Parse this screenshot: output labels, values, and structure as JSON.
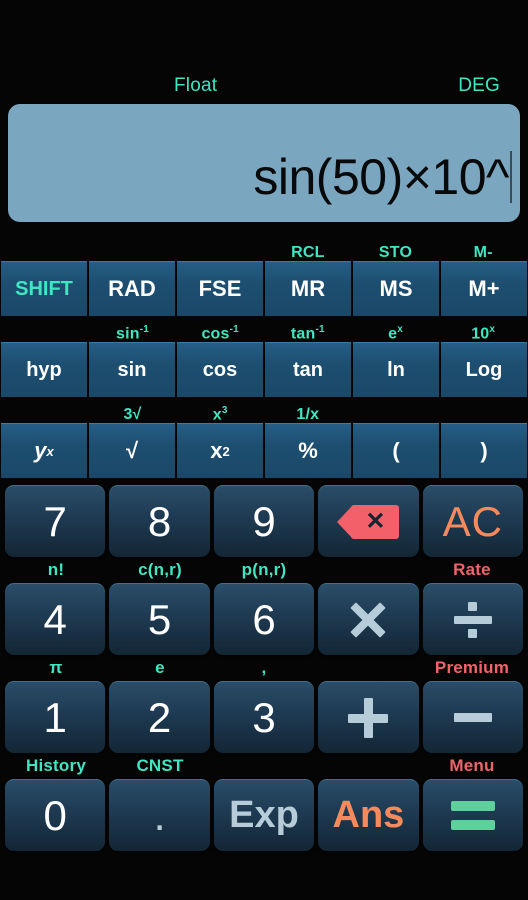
{
  "display": {
    "mode_float": "Float",
    "mode_angle": "DEG",
    "expression": "sin(50)×10^"
  },
  "function_rows": [
    {
      "secondary": [
        "",
        "",
        "",
        "RCL",
        "STO",
        "M-"
      ],
      "keys": [
        {
          "label": "SHIFT",
          "style": "shift"
        },
        {
          "label": "RAD",
          "style": "plain"
        },
        {
          "label": "FSE",
          "style": "plain"
        },
        {
          "label": "MR",
          "style": "plain"
        },
        {
          "label": "MS",
          "style": "plain"
        },
        {
          "label": "M+",
          "style": "plain"
        }
      ]
    },
    {
      "secondary": [
        "",
        "sin-1",
        "cos-1",
        "tan-1",
        "e^x",
        "10^x"
      ],
      "secondary_base": [
        "",
        "sin",
        "cos",
        "tan",
        "e",
        "10"
      ],
      "secondary_sup": [
        "",
        "-1",
        "-1",
        "-1",
        "x",
        "x"
      ],
      "keys": [
        {
          "label": "hyp",
          "style": "plain"
        },
        {
          "label": "sin",
          "style": "plain"
        },
        {
          "label": "cos",
          "style": "plain"
        },
        {
          "label": "tan",
          "style": "plain"
        },
        {
          "label": "ln",
          "style": "plain"
        },
        {
          "label": "Log",
          "style": "plain"
        }
      ]
    },
    {
      "secondary": [
        "",
        "3√",
        "x3",
        "1/x",
        "",
        ""
      ],
      "secondary_base": [
        "",
        "3√",
        "x",
        "1/x",
        "",
        ""
      ],
      "secondary_sup": [
        "",
        "",
        "3",
        "",
        "",
        ""
      ],
      "keys": [
        {
          "label": "y^x",
          "style": "pow"
        },
        {
          "label": "√",
          "style": "plain"
        },
        {
          "label": "x2",
          "style": "sq"
        },
        {
          "label": "%",
          "style": "plain"
        },
        {
          "label": "(",
          "style": "plain"
        },
        {
          "label": ")",
          "style": "plain"
        }
      ]
    }
  ],
  "keypad": [
    {
      "labels": [
        "",
        "",
        "",
        "",
        ""
      ],
      "label_colors": [
        "cyan",
        "cyan",
        "cyan",
        "cyan",
        "red"
      ],
      "keys": [
        {
          "name": "seven",
          "label": "7",
          "style": "num"
        },
        {
          "name": "eight",
          "label": "8",
          "style": "num"
        },
        {
          "name": "nine",
          "label": "9",
          "style": "num"
        },
        {
          "name": "backspace",
          "label": "",
          "style": "backspace"
        },
        {
          "name": "all-clear",
          "label": "AC",
          "style": "ac"
        }
      ]
    },
    {
      "labels": [
        "n!",
        "c(n,r)",
        "p(n,r)",
        "",
        "Rate"
      ],
      "label_colors": [
        "cyan",
        "cyan",
        "cyan",
        "cyan",
        "red"
      ],
      "keys": [
        {
          "name": "four",
          "label": "4",
          "style": "num"
        },
        {
          "name": "five",
          "label": "5",
          "style": "num"
        },
        {
          "name": "six",
          "label": "6",
          "style": "num"
        },
        {
          "name": "multiply",
          "label": "×",
          "style": "times"
        },
        {
          "name": "divide",
          "label": "÷",
          "style": "divide"
        }
      ]
    },
    {
      "labels": [
        "π",
        "e",
        ",",
        "",
        "Premium"
      ],
      "label_colors": [
        "cyan",
        "cyan",
        "cyan",
        "cyan",
        "red"
      ],
      "keys": [
        {
          "name": "one",
          "label": "1",
          "style": "num"
        },
        {
          "name": "two",
          "label": "2",
          "style": "num"
        },
        {
          "name": "three",
          "label": "3",
          "style": "num"
        },
        {
          "name": "plus",
          "label": "+",
          "style": "plus"
        },
        {
          "name": "minus",
          "label": "−",
          "style": "minus"
        }
      ]
    },
    {
      "labels": [
        "History",
        "CNST",
        "",
        "",
        "Menu"
      ],
      "label_colors": [
        "cyan",
        "cyan",
        "cyan",
        "cyan",
        "red"
      ],
      "keys": [
        {
          "name": "zero",
          "label": "0",
          "style": "num"
        },
        {
          "name": "decimal-point",
          "label": ".",
          "style": "dot"
        },
        {
          "name": "exponent",
          "label": "Exp",
          "style": "exp"
        },
        {
          "name": "answer",
          "label": "Ans",
          "style": "ans"
        },
        {
          "name": "equals",
          "label": "=",
          "style": "equals"
        }
      ]
    }
  ],
  "colors": {
    "display_bg": "#7ba6bf",
    "accent_cyan": "#3ee6c2",
    "accent_orange": "#f68a5c",
    "accent_red": "#f1636b",
    "accent_green": "#5fcf9b",
    "key_blue": "#1e3a52",
    "fn_blue": "#1d4e70"
  }
}
